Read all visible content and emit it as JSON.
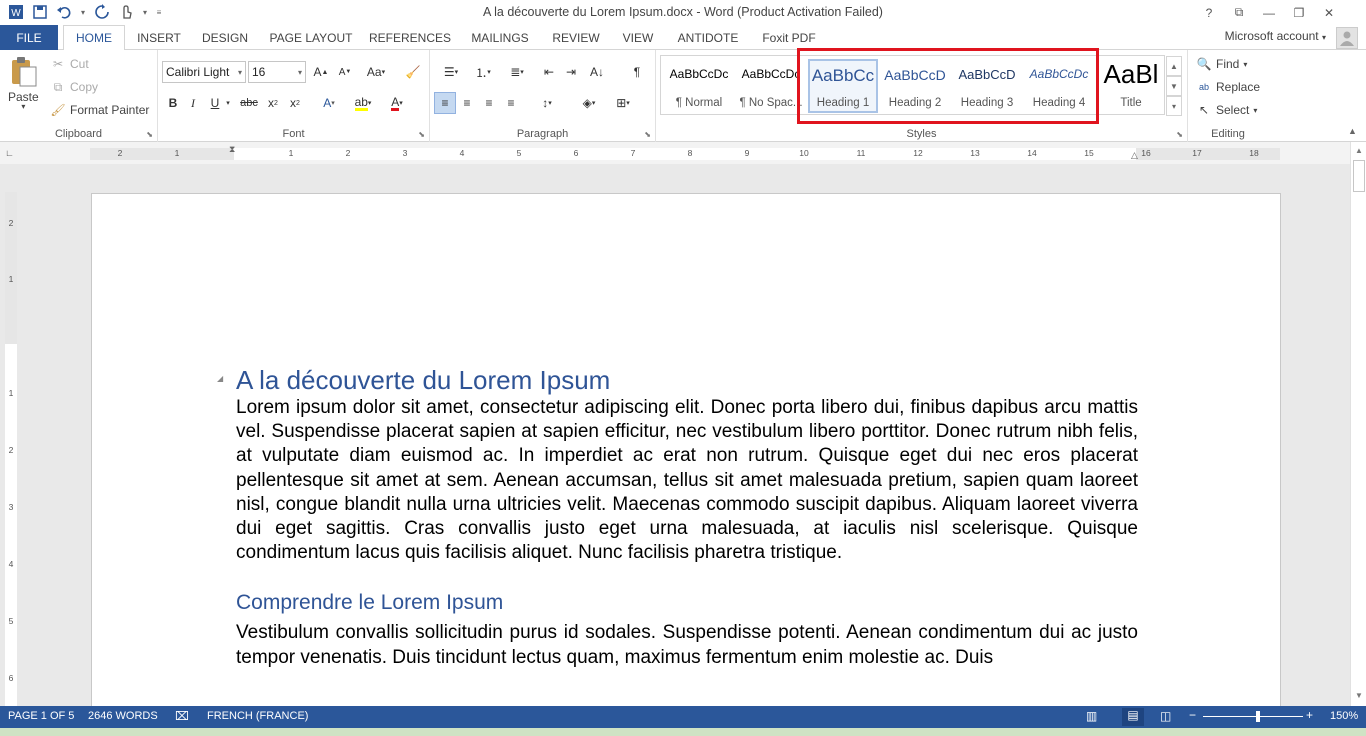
{
  "title_bar": {
    "title": "A la découverte du Lorem Ipsum.docx - Word (Product Activation Failed)",
    "icons": [
      "word-logo-icon",
      "save-icon",
      "undo-icon",
      "redo-icon",
      "touch-mode-icon",
      "customize-qat-icon"
    ],
    "controls": [
      "?",
      "⧉",
      "—",
      "❐",
      "✕"
    ]
  },
  "tabs": {
    "file": "FILE",
    "items": [
      "HOME",
      "INSERT",
      "DESIGN",
      "PAGE LAYOUT",
      "REFERENCES",
      "MAILINGS",
      "REVIEW",
      "VIEW",
      "ANTIDOTE",
      "Foxit PDF"
    ],
    "active": "HOME",
    "account": "Microsoft account"
  },
  "clipboard": {
    "label": "Clipboard",
    "paste": "Paste",
    "cut": "Cut",
    "copy": "Copy",
    "format_painter": "Format Painter"
  },
  "font": {
    "label": "Font",
    "family": "Calibri Light",
    "size": "16"
  },
  "paragraph": {
    "label": "Paragraph"
  },
  "styles": {
    "label": "Styles",
    "items": [
      {
        "preview": "AaBbCcDc",
        "name": "¶ Normal"
      },
      {
        "preview": "AaBbCcDc",
        "name": "¶ No Spac..."
      },
      {
        "preview": "AaBbCc",
        "name": "Heading 1"
      },
      {
        "preview": "AaBbCcD",
        "name": "Heading 2"
      },
      {
        "preview": "AaBbCcD",
        "name": "Heading 3"
      },
      {
        "preview": "AaBbCcDc",
        "name": "Heading 4"
      },
      {
        "preview": "AaBl",
        "name": "Title"
      }
    ],
    "selected": "Heading 1"
  },
  "editing": {
    "label": "Editing",
    "find": "Find",
    "replace": "Replace",
    "select": "Select"
  },
  "ruler": {
    "h_numbers": [
      "2",
      "1",
      "1",
      "2",
      "3",
      "4",
      "5",
      "6",
      "7",
      "8",
      "9",
      "10",
      "11",
      "12",
      "13",
      "14",
      "15",
      "16",
      "17",
      "18"
    ],
    "v_numbers": [
      "2",
      "1",
      "1",
      "2",
      "3",
      "4",
      "5",
      "6"
    ]
  },
  "document": {
    "heading1": "A la découverte du Lorem Ipsum",
    "paragraph1": "Lorem ipsum dolor sit amet, consectetur adipiscing elit. Donec porta libero dui, finibus dapibus arcu mattis vel. Suspendisse placerat sapien at sapien efficitur, nec vestibulum libero porttitor. Donec rutrum nibh felis, at vulputate diam euismod ac. In imperdiet ac erat non rutrum. Quisque eget dui nec eros placerat pellentesque sit amet at sem. Aenean accumsan, tellus sit amet malesuada pretium, sapien quam laoreet nisl, congue blandit nulla urna ultricies velit. Maecenas commodo suscipit dapibus. Aliquam laoreet viverra dui eget sagittis. Cras convallis justo eget urna malesuada, at iaculis nisl scelerisque. Quisque condimentum lacus quis facilisis aliquet. Nunc facilisis pharetra tristique.",
    "heading2": "Comprendre le Lorem Ipsum",
    "paragraph2": "Vestibulum convallis sollicitudin purus id sodales. Suspendisse potenti. Aenean condimentum dui ac justo tempor venenatis. Duis tincidunt lectus quam, maximus fermentum enim molestie ac. Duis"
  },
  "status": {
    "page": "PAGE 1 OF 5",
    "words": "2646 WORDS",
    "language": "FRENCH (FRANCE)",
    "zoom": "150%",
    "zoom_level": 150
  },
  "colors": {
    "brand": "#2b579a",
    "heading": "#2f5496",
    "highlight": "#e0141e"
  }
}
